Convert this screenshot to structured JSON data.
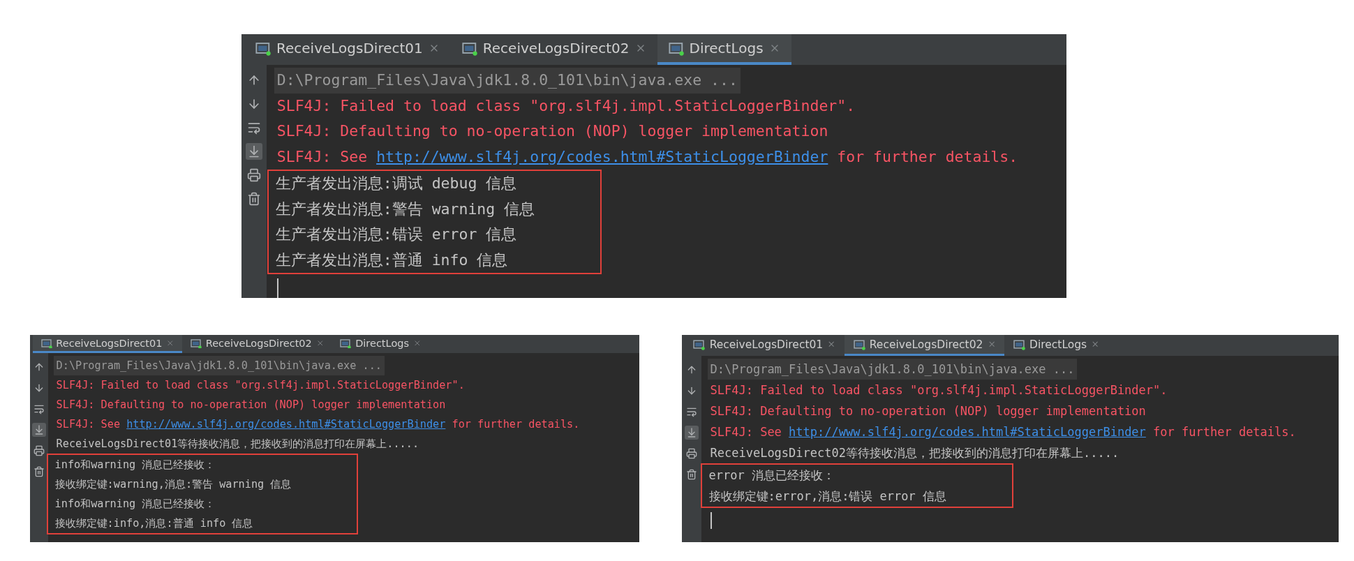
{
  "panels": [
    {
      "tabs": [
        {
          "label": "ReceiveLogsDirect01",
          "selected": false
        },
        {
          "label": "ReceiveLogsDirect02",
          "selected": false
        },
        {
          "label": "DirectLogs",
          "selected": true
        }
      ],
      "scroll_to_end": true,
      "lines": [
        {
          "kind": "command",
          "text": "D:\\Program_Files\\Java\\jdk1.8.0_101\\bin\\java.exe ..."
        },
        {
          "kind": "error",
          "text": "SLF4J: Failed to load class \"org.slf4j.impl.StaticLoggerBinder\"."
        },
        {
          "kind": "error",
          "text": "SLF4J: Defaulting to no-operation (NOP) logger implementation"
        },
        {
          "kind": "error_link",
          "text": "SLF4J: See ",
          "link": "http://www.slf4j.org/codes.html#StaticLoggerBinder",
          "after": " for further details."
        }
      ],
      "framed_lines": [
        {
          "kind": "output",
          "text": "生产者发出消息:调试 debug 信息"
        },
        {
          "kind": "output",
          "text": "生产者发出消息:警告 warning 信息"
        },
        {
          "kind": "output",
          "text": "生产者发出消息:错误 error 信息"
        },
        {
          "kind": "output",
          "text": "生产者发出消息:普通 info 信息"
        }
      ],
      "cursor": true
    },
    {
      "tabs": [
        {
          "label": "ReceiveLogsDirect01",
          "selected": true
        },
        {
          "label": "ReceiveLogsDirect02",
          "selected": false
        },
        {
          "label": "DirectLogs",
          "selected": false
        }
      ],
      "scroll_to_end": true,
      "lines": [
        {
          "kind": "command",
          "text": "D:\\Program_Files\\Java\\jdk1.8.0_101\\bin\\java.exe ..."
        },
        {
          "kind": "error",
          "text": "SLF4J: Failed to load class \"org.slf4j.impl.StaticLoggerBinder\"."
        },
        {
          "kind": "error",
          "text": "SLF4J: Defaulting to no-operation (NOP) logger implementation"
        },
        {
          "kind": "error_link",
          "text": "SLF4J: See ",
          "link": "http://www.slf4j.org/codes.html#StaticLoggerBinder",
          "after": " for further details."
        },
        {
          "kind": "output",
          "text": "ReceiveLogsDirect01等待接收消息，把接收到的消息打印在屏幕上....."
        }
      ],
      "framed_lines": [
        {
          "kind": "output",
          "text": "info和warning 消息已经接收："
        },
        {
          "kind": "output",
          "text": "接收绑定键:warning,消息:警告 warning 信息"
        },
        {
          "kind": "output",
          "text": "info和warning 消息已经接收："
        },
        {
          "kind": "output",
          "text": "接收绑定键:info,消息:普通 info 信息"
        }
      ]
    },
    {
      "tabs": [
        {
          "label": "ReceiveLogsDirect01",
          "selected": false
        },
        {
          "label": "ReceiveLogsDirect02",
          "selected": true
        },
        {
          "label": "DirectLogs",
          "selected": false
        }
      ],
      "scroll_to_end": true,
      "lines": [
        {
          "kind": "command",
          "text": "D:\\Program_Files\\Java\\jdk1.8.0_101\\bin\\java.exe ..."
        },
        {
          "kind": "error",
          "text": "SLF4J: Failed to load class \"org.slf4j.impl.StaticLoggerBinder\"."
        },
        {
          "kind": "error",
          "text": "SLF4J: Defaulting to no-operation (NOP) logger implementation"
        },
        {
          "kind": "error_link",
          "text": "SLF4J: See ",
          "link": "http://www.slf4j.org/codes.html#StaticLoggerBinder",
          "after": " for further details."
        },
        {
          "kind": "output",
          "text": "ReceiveLogsDirect02等待接收消息，把接收到的消息打印在屏幕上....."
        }
      ],
      "framed_lines": [
        {
          "kind": "output",
          "text": "error 消息已经接收："
        },
        {
          "kind": "output",
          "text": "接收绑定键:error,消息:错误 error 信息"
        }
      ],
      "cursor": true
    }
  ]
}
